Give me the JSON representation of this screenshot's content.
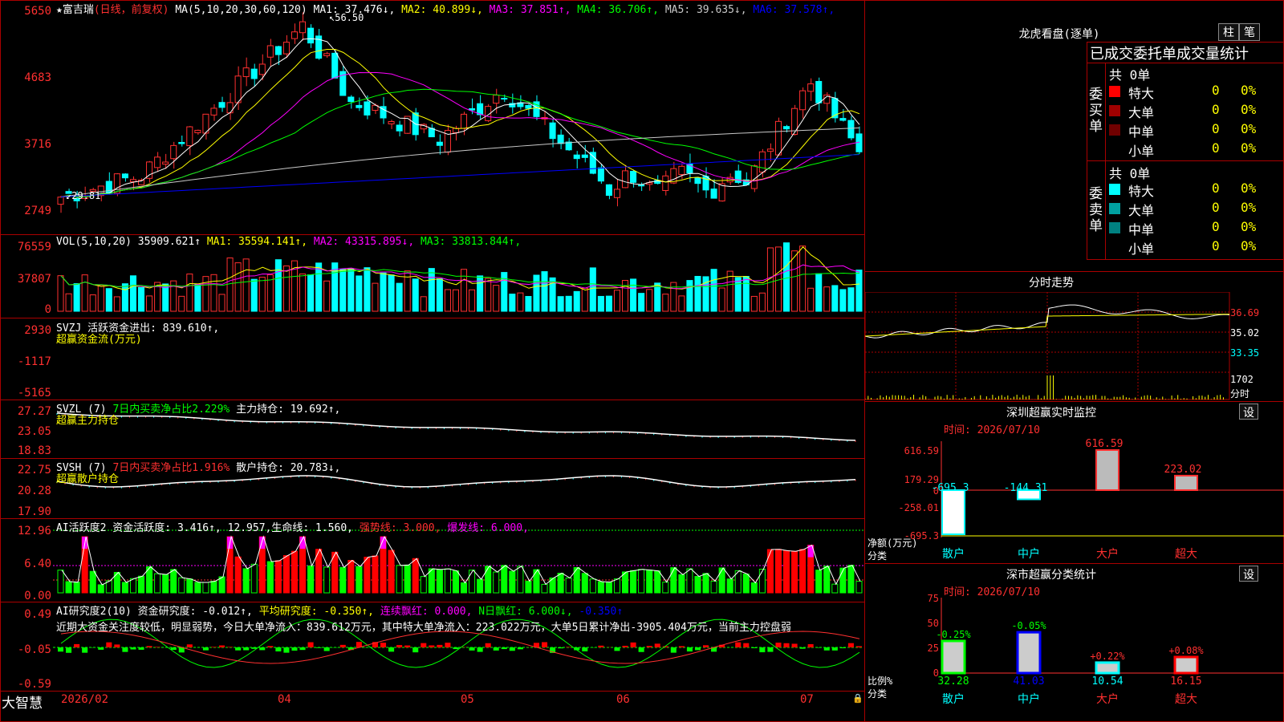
{
  "main": {
    "stock_name": "富吉瑞",
    "mode": "(日线，前复权)",
    "ma_header": "MA(5,10,20,30,60,120)",
    "ma": [
      {
        "label": "MA1: 37.476↓",
        "color": "#ffffff"
      },
      {
        "label": "MA2: 40.899↓",
        "color": "#ffff00"
      },
      {
        "label": "MA3: 37.851↑",
        "color": "#ff00ff"
      },
      {
        "label": "MA4: 36.706↑",
        "color": "#00ff00"
      },
      {
        "label": "MA5: 39.635↓",
        "color": "#c8c8c8"
      },
      {
        "label": "MA6: 37.578↑",
        "color": "#0000ff"
      }
    ],
    "y_labels": [
      "5650",
      "4683",
      "3716",
      "2749"
    ],
    "high_mark": "56.50",
    "low_mark": "29.81"
  },
  "vol": {
    "header": "VOL(5,10,20)",
    "value": "35909.621↑",
    "ma": [
      {
        "label": "MA1: 35594.141↑",
        "color": "#ffff00"
      },
      {
        "label": "MA2: 43315.895↓",
        "color": "#ff00ff"
      },
      {
        "label": "MA3: 33813.844↑",
        "color": "#00ff00"
      }
    ],
    "y_labels": [
      "76559",
      "37807",
      "0"
    ]
  },
  "svzj": {
    "header": "SVZJ  活跃资金进出: 839.610↑,",
    "sub": "超赢资金流(万元)",
    "y_labels": [
      "2930",
      "-1117",
      "-5165"
    ]
  },
  "svzl": {
    "header": "SVZL (7)",
    "ratio": "7日内买卖净占比2.229%",
    "hold": "主力持仓: 19.692↑,",
    "sub": "超赢主力持仓",
    "y_labels": [
      "27.27",
      "23.05",
      "18.83"
    ]
  },
  "svsh": {
    "header": "SVSH (7)",
    "ratio": "7日内买卖净占比1.916%",
    "hold": "散户持仓: 20.783↓,",
    "sub": "超赢散户持仓",
    "y_labels": [
      "22.75",
      "20.28",
      "17.90"
    ]
  },
  "ai_active": {
    "header": "AI活跃度2 资金活跃度: 3.416↑, 12.957,",
    "life": "生命线: 1.560,",
    "strong": "强势线: 3.000,",
    "burst": "爆发线: 6.000,",
    "y_labels": [
      "12.96",
      "6.40",
      "0.00"
    ]
  },
  "ai_research": {
    "header": "AI研究度2(10) 资金研究度: -0.012↑,",
    "avg": "平均研究度: -0.350↑,",
    "red": "连续飘红: 0.000,",
    "n_red": "N日飘红: 6.000↓,",
    "last": "-0.350↑",
    "comment": "近期大资金关注度较低，明显弱势，今日大单净流入：839.612万元，其中特大单净流入：223.022万元，大单5日累计净出-3905.404万元，当前主力控盘弱",
    "y_labels": [
      "0.49",
      "-0.05",
      "-0.59"
    ]
  },
  "xaxis": {
    "brand": "大智慧",
    "labels": [
      "2026/02",
      "04",
      "05",
      "06",
      "07"
    ]
  },
  "lhb": {
    "title": "龙虎看盘(逐单)",
    "btn_bar": "柱",
    "btn_pen": "笔",
    "tabs": "已成交委托单成交量统计",
    "buy_side": "委买单",
    "sell_side": "委卖单",
    "buy_total": "共 0单",
    "sell_total": "共 0单",
    "buy_rows": [
      {
        "name": "特大",
        "count": "0",
        "pct": "0%",
        "color": "#ff0000"
      },
      {
        "name": "大单",
        "count": "0",
        "pct": "0%",
        "color": "#a00000"
      },
      {
        "name": "中单",
        "count": "0",
        "pct": "0%",
        "color": "#700000"
      },
      {
        "name": "小单",
        "count": "0",
        "pct": "0%",
        "color": "#000000"
      }
    ],
    "sell_rows": [
      {
        "name": "特大",
        "count": "0",
        "pct": "0%",
        "color": "#00ffff"
      },
      {
        "name": "大单",
        "count": "0",
        "pct": "0%",
        "color": "#00a0a0"
      },
      {
        "name": "中单",
        "count": "0",
        "pct": "0%",
        "color": "#008080"
      },
      {
        "name": "小单",
        "count": "0",
        "pct": "0%",
        "color": "#000000"
      }
    ]
  },
  "intraday": {
    "title": "分时走势",
    "y_labels": [
      "36.69",
      "35.02",
      "33.35"
    ],
    "vol_label": "1702",
    "vol_unit": "分时"
  },
  "monitor": {
    "title": "深圳超赢实时监控",
    "btn": "设",
    "time": "时间: 2026/07/10",
    "y_labels": [
      "616.59",
      "179.29",
      "0",
      "-258.01",
      "-695.3"
    ],
    "unit1": "净额(万元)",
    "unit2": "分类",
    "cats": [
      "散户",
      "中户",
      "大户",
      "超大"
    ],
    "values": [
      -695.3,
      -144.31,
      616.59,
      223.02
    ],
    "value_labels": [
      "-695.3",
      "-144.31",
      "616.59",
      "223.02"
    ]
  },
  "classify": {
    "title": "深市超赢分类统计",
    "btn": "设",
    "time": "时间: 2026/07/10",
    "y_labels": [
      "75",
      "50",
      "25",
      "0"
    ],
    "unit1": "比例%",
    "unit2": "分类",
    "cats": [
      "散户",
      "中户",
      "大户",
      "超大"
    ],
    "values": [
      32.28,
      41.03,
      10.54,
      16.15
    ],
    "value_labels": [
      "32.28",
      "41.03",
      "10.54",
      "16.15"
    ],
    "changes": [
      "-0.25%",
      "-0.05%",
      "+0.22%",
      "+0.08%"
    ]
  },
  "colors": {
    "up": "#ff0000",
    "down": "#00ffff",
    "frame": "#aa0000"
  }
}
